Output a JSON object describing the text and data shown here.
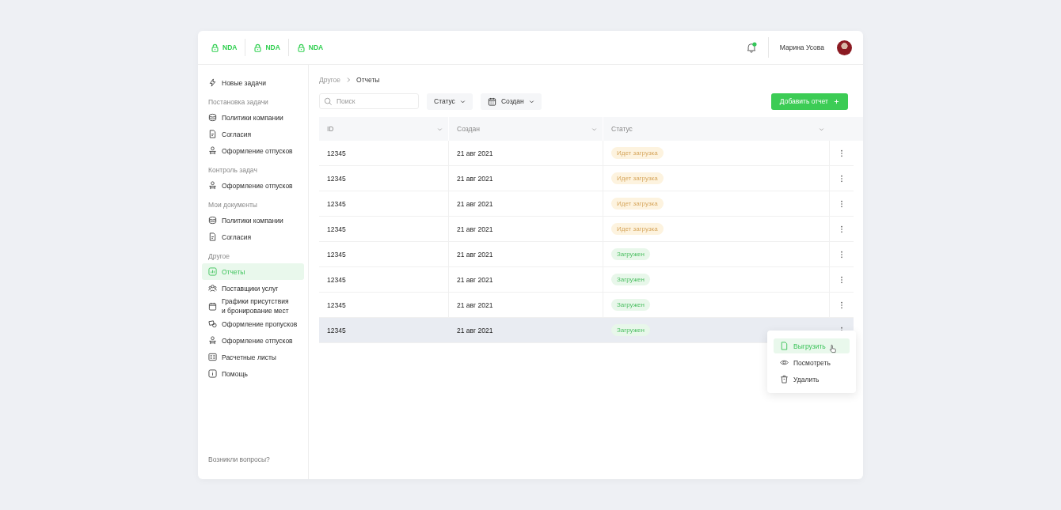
{
  "header": {
    "nda_tabs": [
      {
        "label": "NDA"
      },
      {
        "label": "NDA"
      },
      {
        "label": "NDA"
      }
    ],
    "user": {
      "name": "Марина Усова"
    }
  },
  "sidebar": {
    "top_item": {
      "label": "Новые задачи",
      "selected": false
    },
    "groups": [
      {
        "heading": "Постановка задачи",
        "items": [
          {
            "label": "Политики компании",
            "selected": false
          },
          {
            "label": "Согласия",
            "selected": false
          },
          {
            "label": "Оформление отпусков",
            "selected": false
          }
        ]
      },
      {
        "heading": "Контроль задач",
        "items": [
          {
            "label": "Оформление отпусков",
            "selected": false
          }
        ]
      },
      {
        "heading": "Мои документы",
        "items": [
          {
            "label": "Политики компании",
            "selected": false
          },
          {
            "label": "Согласия",
            "selected": false
          }
        ]
      },
      {
        "heading": "Другое",
        "items": [
          {
            "label": "Отчеты",
            "selected": true
          },
          {
            "label": "Поставщики услуг",
            "selected": false
          },
          {
            "label": "Графики присутствия\n и бронирование мест",
            "selected": false
          },
          {
            "label": "Оформление пропусков",
            "selected": false
          },
          {
            "label": "Оформление отпусков",
            "selected": false
          },
          {
            "label": "Расчетные листы",
            "selected": false
          },
          {
            "label": "Помощь",
            "selected": false
          }
        ]
      }
    ],
    "footer_link": "Возникли вопросы?"
  },
  "breadcrumb": [
    "Другое",
    "Отчеты"
  ],
  "toolbar": {
    "search": {
      "placeholder": "Поиск"
    },
    "filters": [
      "Статус",
      "Создан"
    ],
    "add_button": "Добавить отчет"
  },
  "table": {
    "columns": [
      "ID",
      "Создан",
      "Статус"
    ],
    "rows": [
      {
        "id": "12345",
        "created": "21 авг 2021",
        "status": {
          "label": "Идет загрузка",
          "kind": "loading"
        },
        "selected": false
      },
      {
        "id": "12345",
        "created": "21 авг 2021",
        "status": {
          "label": "Идет загрузка",
          "kind": "loading"
        },
        "selected": false
      },
      {
        "id": "12345",
        "created": "21 авг 2021",
        "status": {
          "label": "Идет загрузка",
          "kind": "loading"
        },
        "selected": false
      },
      {
        "id": "12345",
        "created": "21 авг 2021",
        "status": {
          "label": "Идет загрузка",
          "kind": "loading"
        },
        "selected": false
      },
      {
        "id": "12345",
        "created": "21 авг 2021",
        "status": {
          "label": "Загружен",
          "kind": "loaded"
        },
        "selected": false
      },
      {
        "id": "12345",
        "created": "21 авг 2021",
        "status": {
          "label": "Загружен",
          "kind": "loaded"
        },
        "selected": false
      },
      {
        "id": "12345",
        "created": "21 авг 2021",
        "status": {
          "label": "Загружен",
          "kind": "loaded"
        },
        "selected": false
      },
      {
        "id": "12345",
        "created": "21 авг 2021",
        "status": {
          "label": "Загружен",
          "kind": "loaded"
        },
        "selected": true
      }
    ]
  },
  "row_menu": {
    "items": [
      {
        "label": "Выгрузить",
        "selected": true
      },
      {
        "label": "Посмотреть",
        "selected": false
      },
      {
        "label": "Удалить",
        "selected": false
      }
    ]
  }
}
